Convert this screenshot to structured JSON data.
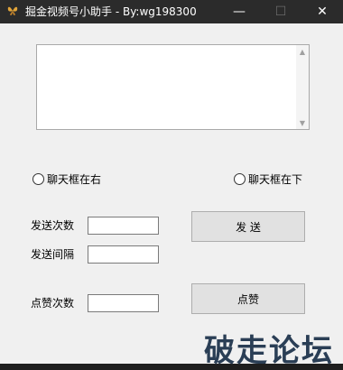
{
  "window": {
    "title": "掘金视频号小助手 - By:wg198300",
    "minimize_glyph": "—",
    "maximize_glyph": "☐",
    "close_glyph": "✕"
  },
  "log_box": {
    "value": "",
    "scroll_up_glyph": "▲",
    "scroll_down_glyph": "▼"
  },
  "chat_position": {
    "option_right": "聊天框在右",
    "option_bottom": "聊天框在下"
  },
  "send": {
    "count_label": "发送次数",
    "count_value": "",
    "interval_label": "发送间隔",
    "interval_value": "",
    "button_label": "发 送"
  },
  "like": {
    "count_label": "点赞次数",
    "count_value": "",
    "button_label": "点赞"
  },
  "watermark": {
    "text": "破走论坛"
  }
}
